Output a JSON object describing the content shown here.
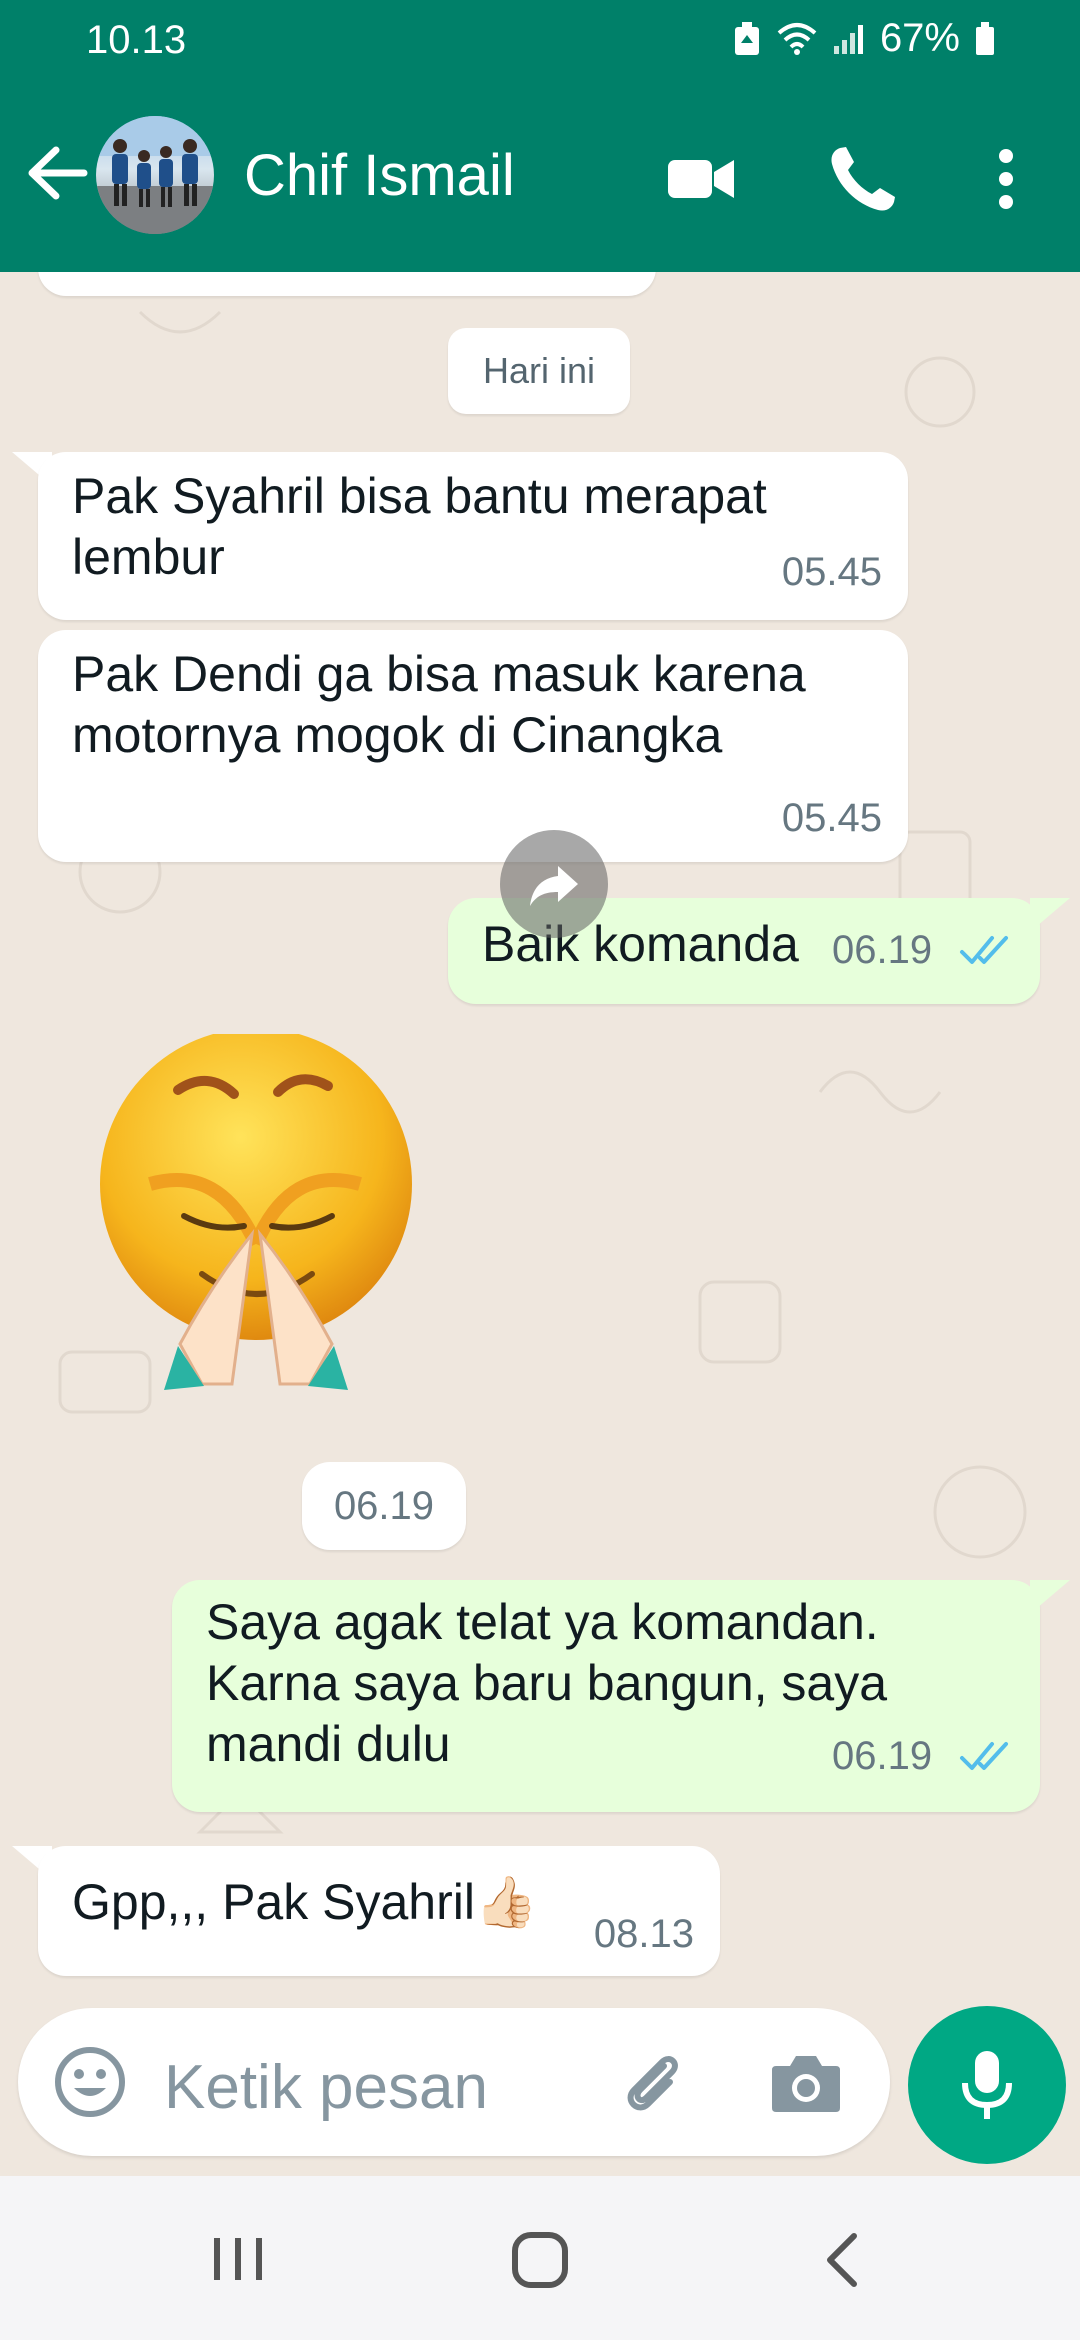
{
  "status_bar": {
    "time": "10.13",
    "battery": "67%"
  },
  "header": {
    "contact_name": "Chif Ismail"
  },
  "chat": {
    "date_chip": "Hari ini",
    "messages": [
      {
        "text_lines": [
          "Pak Syahril bisa bantu merapat",
          "lembur"
        ],
        "time": "05.45",
        "direction": "in"
      },
      {
        "text_lines": [
          "Pak Dendi ga bisa masuk karena",
          "motornya mogok di Cinangka"
        ],
        "time": "05.45",
        "direction": "in"
      },
      {
        "text": "Baik komanda",
        "time": "06.19",
        "direction": "out",
        "status": "read"
      },
      {
        "sticker": "praying-smiley-sticker",
        "time": "06.19",
        "direction": "in"
      },
      {
        "text_lines": [
          "Saya agak telat ya komandan.",
          "Karna saya baru bangun, saya",
          "mandi dulu"
        ],
        "time": "06.19",
        "direction": "out",
        "status": "read"
      },
      {
        "text": "Gpp,,, Pak Syahril👍🏻",
        "time": "08.13",
        "direction": "in"
      }
    ]
  },
  "input": {
    "placeholder": "Ketik pesan"
  },
  "colors": {
    "header": "#008069",
    "outgoing_bubble": "#e7ffdb",
    "read_tick": "#53bdeb",
    "mic_button": "#00a884"
  }
}
